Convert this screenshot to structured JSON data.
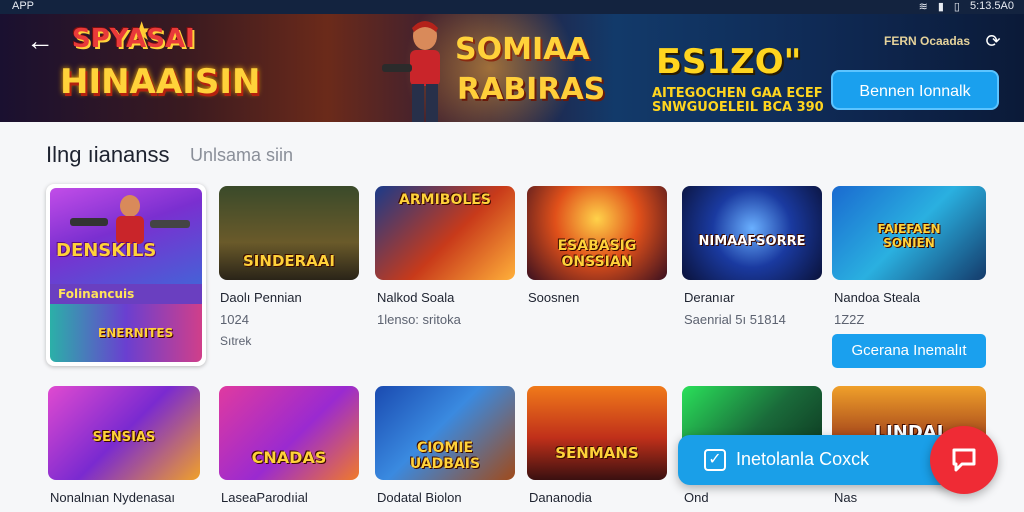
{
  "status_bar": {
    "app_name": "APP",
    "time": "5:13.5A0"
  },
  "banner": {
    "logo_line1": "SPYASAI",
    "logo_line2": "HINAAISIN",
    "promo_title_line1": "SOMIAA",
    "promo_title_line2": "RABIRAS",
    "amount": "ƂS1ZO\"",
    "promo_sub_line1": "AITEGOCHEN GAA ECEF",
    "promo_sub_line2": "SNWGUOELEIL BCA 390",
    "brand": "FERN Ocaadas",
    "cta_label": "Bennen Ionnalk"
  },
  "section": {
    "title": "Ilng ıiananss",
    "subtitle": "Unlsama siin"
  },
  "row1": [
    {
      "name": "Daolı Pennian",
      "meta": "1024",
      "meta2": "Sıtrek",
      "caption": "DENSKILS",
      "caption2": "Folinancuis",
      "caption3": "ENERNITES"
    },
    {
      "name": "Nalkod Soala",
      "meta": "1lenso: sritoka",
      "caption": "SINDERAAI"
    },
    {
      "name": "Soosnen",
      "meta": "",
      "caption": "ARMIBOLES"
    },
    {
      "name": "",
      "meta": "",
      "caption": "ESABASIG\nONSSIAN"
    },
    {
      "name": "Deranıar",
      "meta": "Saenrial 5ı 51814",
      "caption": "NIMAAFSORRE"
    },
    {
      "name": "Nandoa Steala",
      "meta": "1Z2Z",
      "caption": "FAIEFAEN\nSONIEN"
    }
  ],
  "row2": [
    {
      "name": "Nonalnıan Nydenasaı",
      "caption": "SENSIAS"
    },
    {
      "name": "LaseaParodıial",
      "caption": "CNADAS"
    },
    {
      "name": "Dodatal Biolon",
      "caption": "CIOMIE\nUADBAIS"
    },
    {
      "name": "Dananodia",
      "caption": "SENMANS"
    },
    {
      "name": "Ond",
      "caption": ""
    },
    {
      "name": "Nas",
      "caption": "LINDAI"
    }
  ],
  "card_cta_label": "Gcerana Inemalıt",
  "fab": {
    "label": "Inetolanla Coxck"
  },
  "colors": {
    "accent": "#1aa0ee",
    "fab_round": "#ef2b35",
    "banner_dark": "#13233f"
  },
  "icons": [
    "back-arrow-icon",
    "sync-icon",
    "check-icon",
    "chat-icon",
    "wifi-icon",
    "battery-icon"
  ]
}
